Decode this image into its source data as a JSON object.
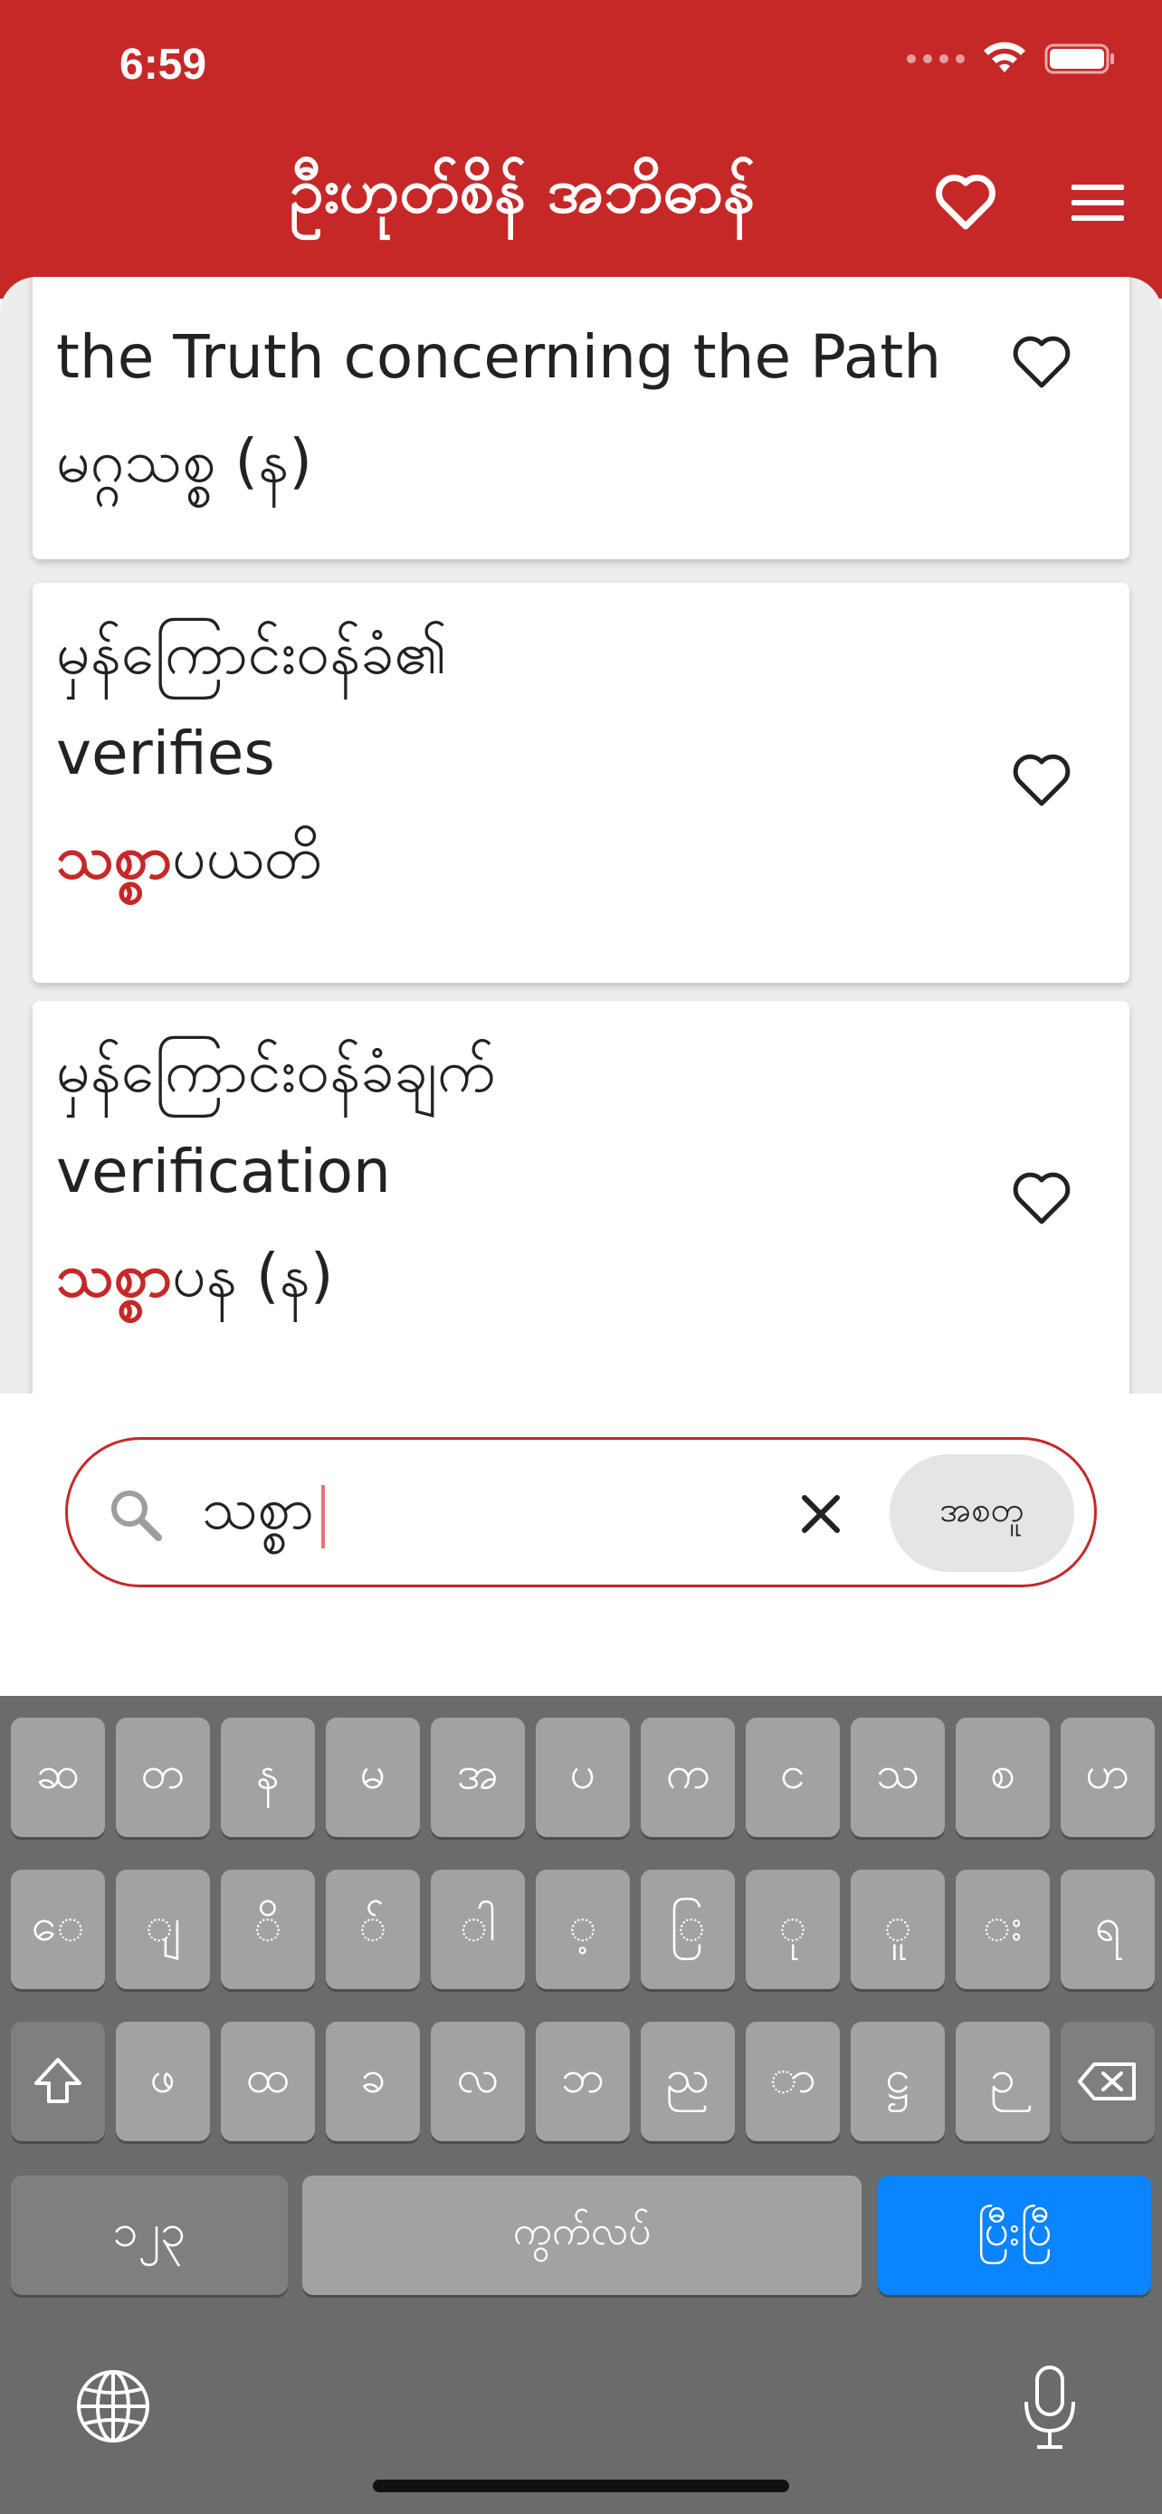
{
  "status_bar": {
    "time": "6:59"
  },
  "header": {
    "title": "ဦးဟုတ်စိန် အဘိဓာန်"
  },
  "results": [
    {
      "lines": [
        {
          "plain": "the Truth concerning the Path"
        },
        {
          "plain": "မဂ္ဂသစ္စ (န)"
        }
      ]
    },
    {
      "lines": [
        {
          "plain": "မှန်ကြောင်းဝန်ခံ၏"
        },
        {
          "plain": "verifies"
        },
        {
          "highlight": "သစ္စာ",
          "rest": "ပယတိ"
        }
      ]
    },
    {
      "lines": [
        {
          "plain": "မှန်ကြောင်းဝန်ခံချက်"
        },
        {
          "plain": "verification"
        },
        {
          "highlight": "သစ္စာ",
          "rest": "ပန (န)"
        }
      ]
    }
  ],
  "search": {
    "value": "သစ္စာ",
    "all_button": "အစတူ"
  },
  "keyboard": {
    "row1": [
      "ဆ",
      "တ",
      "န",
      "မ",
      "အ",
      "ပ",
      "က",
      "င",
      "သ",
      "စ",
      "ဟ"
    ],
    "row2": [
      "ေ",
      "ျ",
      "ိ",
      "်",
      "ါ",
      "့",
      "ြ",
      "ု",
      "ူ",
      "း",
      "ရ"
    ],
    "row3": [
      "ဖ",
      "ထ",
      "ခ",
      "လ",
      "ဘ",
      "ည",
      "ာ",
      "ဋ္ဌ",
      "ဉ"
    ],
    "mode_key": "၁၂၃",
    "space_key": "ကွက်လပ်",
    "done_key": "ပြီးပြီ"
  },
  "colors": {
    "primary": "#c62828",
    "keyboard_bg": "#6b6b6b",
    "key": "#a2a2a2",
    "done_key": "#0a84ff"
  }
}
